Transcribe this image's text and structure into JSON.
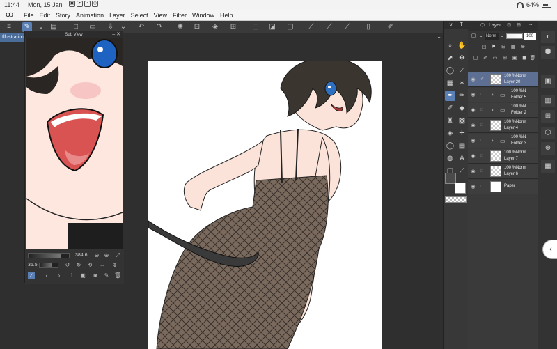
{
  "status_bar": {
    "time": "11:44",
    "date": "Mon, 15 Jan",
    "battery": "64%"
  },
  "menu": {
    "items": [
      "File",
      "Edit",
      "Story",
      "Animation",
      "Layer",
      "Select",
      "View",
      "Filter",
      "Window",
      "Help"
    ]
  },
  "canvas_tab": {
    "label": "Illustration"
  },
  "sub_view": {
    "title": "Sub View",
    "zoom": "384.6",
    "rotation": "35.5"
  },
  "layer_panel": {
    "title": "Layer",
    "blend_mode": "Norm",
    "opacity": "100",
    "layers": [
      {
        "pct": "100 %Norm",
        "name": "Layer 20",
        "type": "layer",
        "selected": true
      },
      {
        "pct": "100 %N",
        "name": "Folder 5",
        "type": "folder"
      },
      {
        "pct": "100 %N",
        "name": "Folder 2",
        "type": "folder"
      },
      {
        "pct": "100 %Norm",
        "name": "Layer 4",
        "type": "layer"
      },
      {
        "pct": "100 %N",
        "name": "Folder 3",
        "type": "folder"
      },
      {
        "pct": "100 %Norm",
        "name": "Layer 7",
        "type": "layer"
      },
      {
        "pct": "100 %Norm",
        "name": "Layer 6",
        "type": "layer"
      },
      {
        "pct": "",
        "name": "Paper",
        "type": "paper"
      }
    ]
  },
  "colors": {
    "accent": "#5a7fb5",
    "selected_layer": "#5d6f93",
    "panel": "#3a3a3a",
    "main_color": "#4a4a4a",
    "sub_color": "#ffffff"
  }
}
